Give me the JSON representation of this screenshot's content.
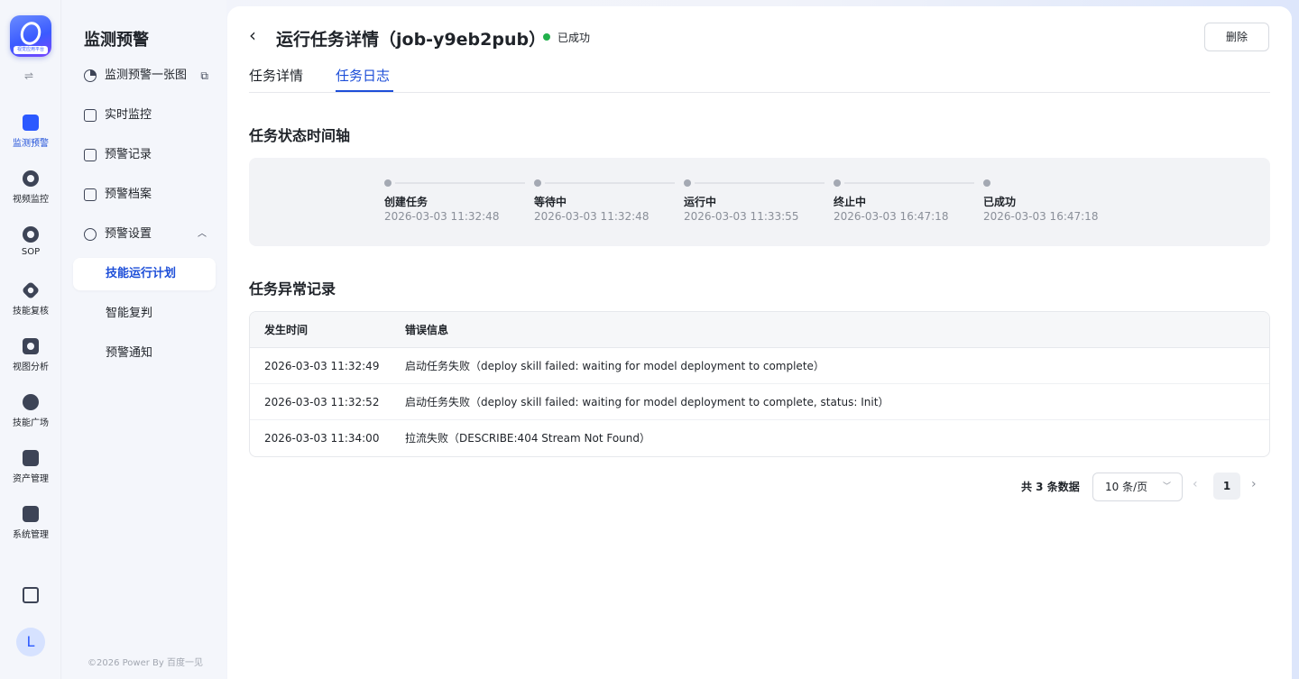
{
  "rail": {
    "logo_caption": "视觉应用平台",
    "toggle_icon": "⇌",
    "items": [
      {
        "label": "监测预警",
        "icon": "line-chart-icon"
      },
      {
        "label": "视频监控",
        "icon": "camera-icon"
      },
      {
        "label": "SOP",
        "icon": "sop-icon"
      },
      {
        "label": "技能复核",
        "icon": "hexagon-check-icon"
      },
      {
        "label": "视图分析",
        "icon": "image-search-icon"
      },
      {
        "label": "技能广场",
        "icon": "skill-circles-icon"
      },
      {
        "label": "资产管理",
        "icon": "asset-icon"
      },
      {
        "label": "系统管理",
        "icon": "settings-panel-icon"
      }
    ],
    "avatar_letter": "L"
  },
  "sidebar": {
    "title": "监测预警",
    "items": [
      {
        "label": "监测预警一张图",
        "ext": "⧉"
      },
      {
        "label": "实时监控"
      },
      {
        "label": "预警记录"
      },
      {
        "label": "预警档案"
      },
      {
        "label": "预警设置",
        "chevron": "︿"
      }
    ],
    "sub_items": [
      {
        "label": "技能运行计划"
      },
      {
        "label": "智能复判"
      },
      {
        "label": "预警通知"
      }
    ],
    "copyright": "©2026 Power By 百度一见"
  },
  "header": {
    "back": "‹",
    "title": "运行任务详情（job-y9eb2pub）",
    "status": "已成功",
    "delete_label": "删除",
    "status_color": "#22b14c"
  },
  "tabs": [
    {
      "label": "任务详情"
    },
    {
      "label": "任务日志"
    }
  ],
  "timeline": {
    "title": "任务状态时间轴",
    "steps": [
      {
        "label": "创建任务",
        "time": "2026-03-03 11:32:48"
      },
      {
        "label": "等待中",
        "time": "2026-03-03 11:32:48"
      },
      {
        "label": "运行中",
        "time": "2026-03-03 11:33:55"
      },
      {
        "label": "终止中",
        "time": "2026-03-03 16:47:18"
      },
      {
        "label": "已成功",
        "time": "2026-03-03 16:47:18"
      }
    ]
  },
  "errors": {
    "title": "任务异常记录",
    "columns": [
      "发生时间",
      "错误信息"
    ],
    "rows": [
      {
        "time": "2026-03-03 11:32:49",
        "message": "启动任务失败（deploy skill failed: waiting for model deployment to complete）"
      },
      {
        "time": "2026-03-03 11:32:52",
        "message": "启动任务失败（deploy skill failed: waiting for model deployment to complete, status: Init）"
      },
      {
        "time": "2026-03-03 11:34:00",
        "message": "拉流失败（DESCRIBE:404 Stream Not Found）"
      }
    ]
  },
  "pagination": {
    "total": "共 3 条数据",
    "page_size": "10 条/页",
    "current_page": "1",
    "prev": "‹",
    "next": "›",
    "dropdown": "﹀"
  },
  "colors": {
    "accent": "#1d4ed8",
    "success": "#22b14c"
  }
}
